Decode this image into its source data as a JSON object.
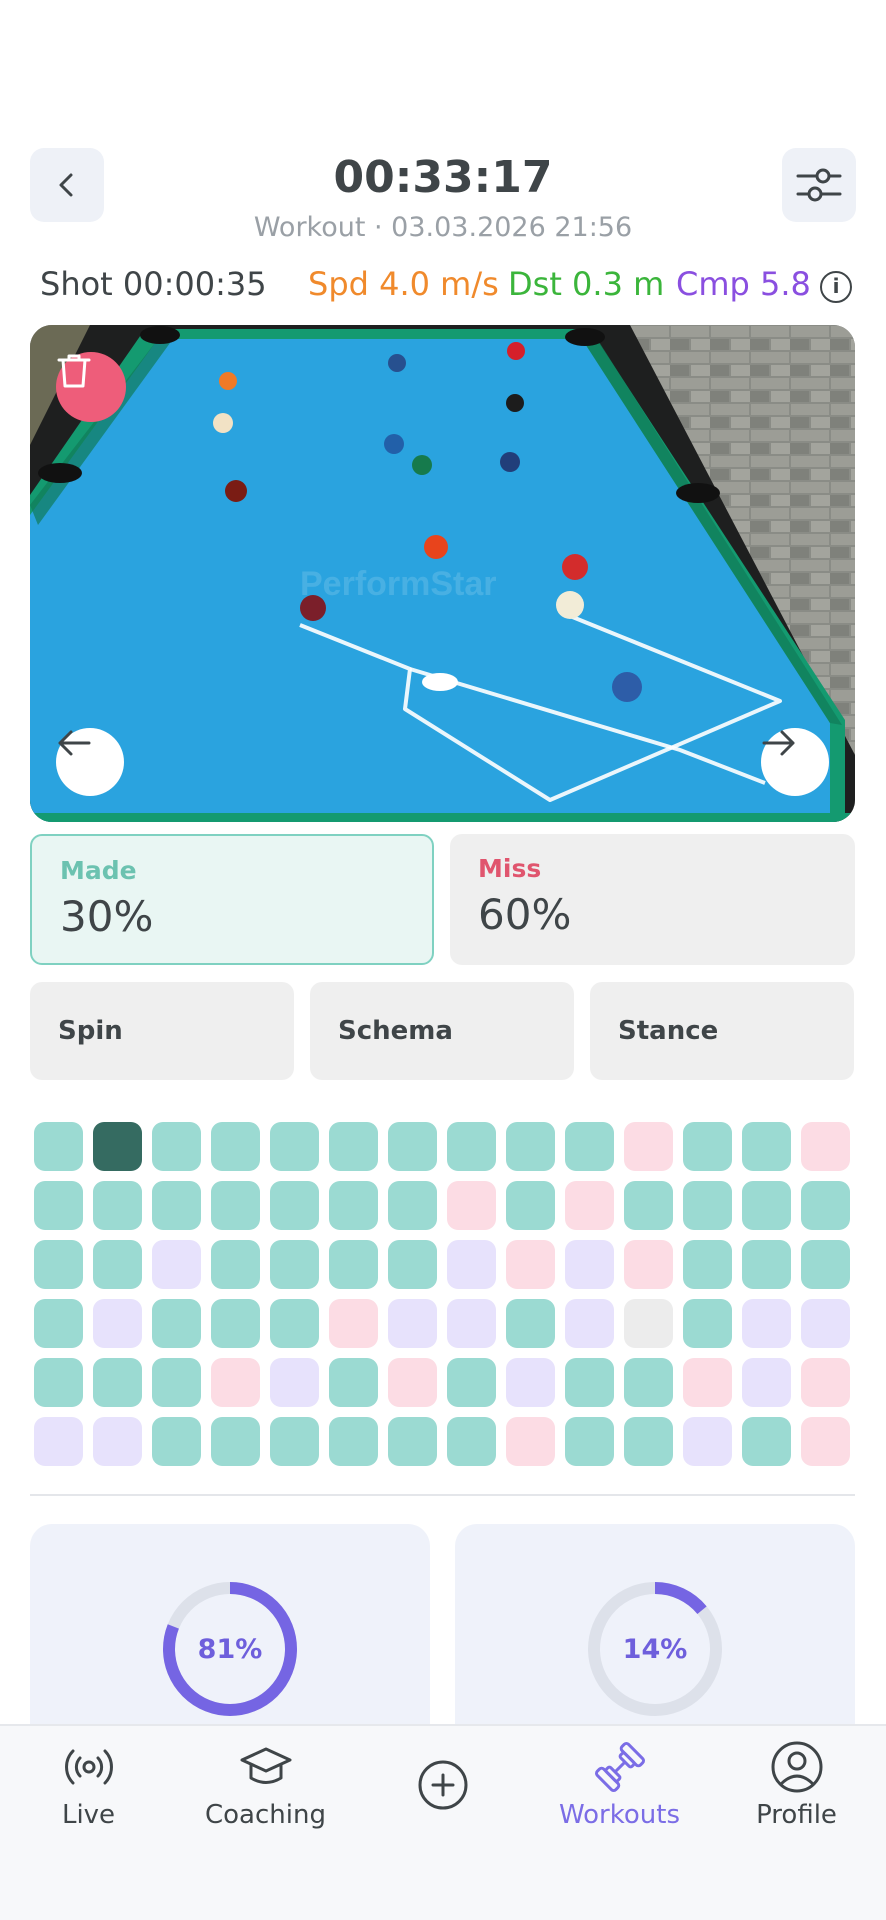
{
  "header": {
    "timer": "00:33:17",
    "subtitle": "Workout · 03.03.2026 21:56",
    "back_icon": "chevron-left-icon",
    "filter_icon": "sliders-icon"
  },
  "metrics": {
    "shot": "Shot 00:00:35",
    "speed": "Spd 4.0 m/s",
    "distance": "Dst 0.3 m",
    "complexity": "Cmp 5.8",
    "info": "i"
  },
  "video": {
    "watermark": "PerformStar",
    "delete_icon": "trash-icon",
    "prev_icon": "arrow-left-icon",
    "next_icon": "arrow-right-icon"
  },
  "results": {
    "made_label": "Made",
    "made_value": "30%",
    "miss_label": "Miss",
    "miss_value": "60%"
  },
  "tags": [
    "Spin",
    "Schema",
    "Stance"
  ],
  "shot_grid": {
    "legend": {
      "m": "made",
      "x": "miss",
      "p": "other",
      "g": "empty",
      "s": "selected"
    },
    "rows": [
      [
        "m",
        "s",
        "m",
        "m",
        "m",
        "m",
        "m",
        "m",
        "m",
        "m",
        "x",
        "m",
        "m",
        "x"
      ],
      [
        "m",
        "m",
        "m",
        "m",
        "m",
        "m",
        "m",
        "x",
        "m",
        "x",
        "m",
        "m",
        "m",
        "m"
      ],
      [
        "m",
        "m",
        "p",
        "m",
        "m",
        "m",
        "m",
        "p",
        "x",
        "p",
        "x",
        "m",
        "m",
        "m"
      ],
      [
        "m",
        "p",
        "m",
        "m",
        "m",
        "x",
        "p",
        "p",
        "m",
        "p",
        "g",
        "m",
        "p",
        "p"
      ],
      [
        "m",
        "m",
        "m",
        "x",
        "p",
        "m",
        "x",
        "m",
        "p",
        "m",
        "m",
        "x",
        "p",
        "x"
      ],
      [
        "p",
        "p",
        "m",
        "m",
        "m",
        "m",
        "m",
        "m",
        "x",
        "m",
        "m",
        "p",
        "m",
        "x"
      ]
    ]
  },
  "summary": [
    {
      "label": "81%",
      "fraction": 0.81
    },
    {
      "label": "14%",
      "fraction": 0.14
    }
  ],
  "colors": {
    "accent": "#7b6de6",
    "ring": "#7565e3",
    "ring_track": "#dde1ea",
    "made": "#9bdad2",
    "miss": "#fcdce4",
    "other": "#e7e2fc",
    "selected": "#356b61",
    "felt": "#2aa3df"
  },
  "tabbar": {
    "tabs": [
      {
        "label": "Live",
        "icon": "broadcast-icon"
      },
      {
        "label": "Coaching",
        "icon": "graduation-cap-icon"
      },
      {
        "label": "",
        "icon": "plus-circle-icon"
      },
      {
        "label": "Workouts",
        "icon": "dumbbell-icon"
      },
      {
        "label": "Profile",
        "icon": "user-circle-icon"
      }
    ],
    "active": 3
  }
}
